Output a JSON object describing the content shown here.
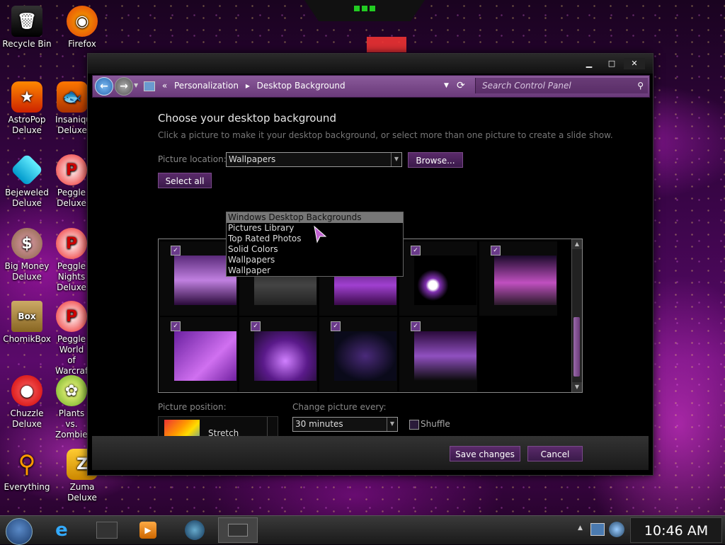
{
  "desktop_icons": [
    {
      "label": "Recycle Bin",
      "icon": "recycle-bin-icon"
    },
    {
      "label": "Firefox",
      "icon": "firefox-icon"
    },
    {
      "label": "AstroPop Deluxe",
      "icon": "astropop-icon"
    },
    {
      "label": "Insaniquarium Deluxe",
      "icon": "insaniquarium-icon"
    },
    {
      "label": "Bejeweled Deluxe",
      "icon": "bejeweled-icon"
    },
    {
      "label": "Peggle Deluxe",
      "icon": "peggle-icon"
    },
    {
      "label": "Big Money Deluxe",
      "icon": "big-money-icon"
    },
    {
      "label": "Peggle Nights Deluxe",
      "icon": "peggle-nights-icon"
    },
    {
      "label": "ChomikBox",
      "icon": "chomikbox-icon"
    },
    {
      "label": "Peggle World of Warcraft",
      "icon": "peggle-wow-icon"
    },
    {
      "label": "Chuzzle Deluxe",
      "icon": "chuzzle-icon"
    },
    {
      "label": "Plants vs. Zombies",
      "icon": "plants-zombies-icon"
    },
    {
      "label": "Everything",
      "icon": "everything-search-icon"
    },
    {
      "label": "Zuma Deluxe",
      "icon": "zuma-icon"
    }
  ],
  "window": {
    "breadcrumb": [
      "Personalization",
      "Desktop Background"
    ],
    "search_placeholder": "Search Control Panel",
    "heading": "Choose your desktop background",
    "subtitle": "Click a picture to make it your desktop background, or select more than one picture to create a slide show.",
    "picture_location_label": "Picture location:",
    "picture_location_value": "Wallpapers",
    "browse_label": "Browse...",
    "select_all_label": "Select all",
    "dropdown_options": [
      "Windows Desktop Backgrounds",
      "Pictures Library",
      "Top Rated Photos",
      "Solid Colors",
      "Wallpapers",
      "Wallpaper"
    ],
    "dropdown_selected_index": 0,
    "picture_position_label": "Picture position:",
    "picture_position_value": "Stretch",
    "change_picture_label": "Change picture every:",
    "change_picture_value": "30 minutes",
    "shuffle_label": "Shuffle",
    "save_label": "Save changes",
    "cancel_label": "Cancel",
    "thumbnails_count": 9
  },
  "taskbar": {
    "clock": "10:46 AM",
    "items": [
      "start-orb-icon",
      "internet-explorer-icon",
      "printer-icon",
      "media-player-icon",
      "globe-icon",
      "window-thumbnail-icon"
    ]
  },
  "colors": {
    "accent": "#6a3a7a",
    "wallpaper": "#5a0a6a"
  }
}
